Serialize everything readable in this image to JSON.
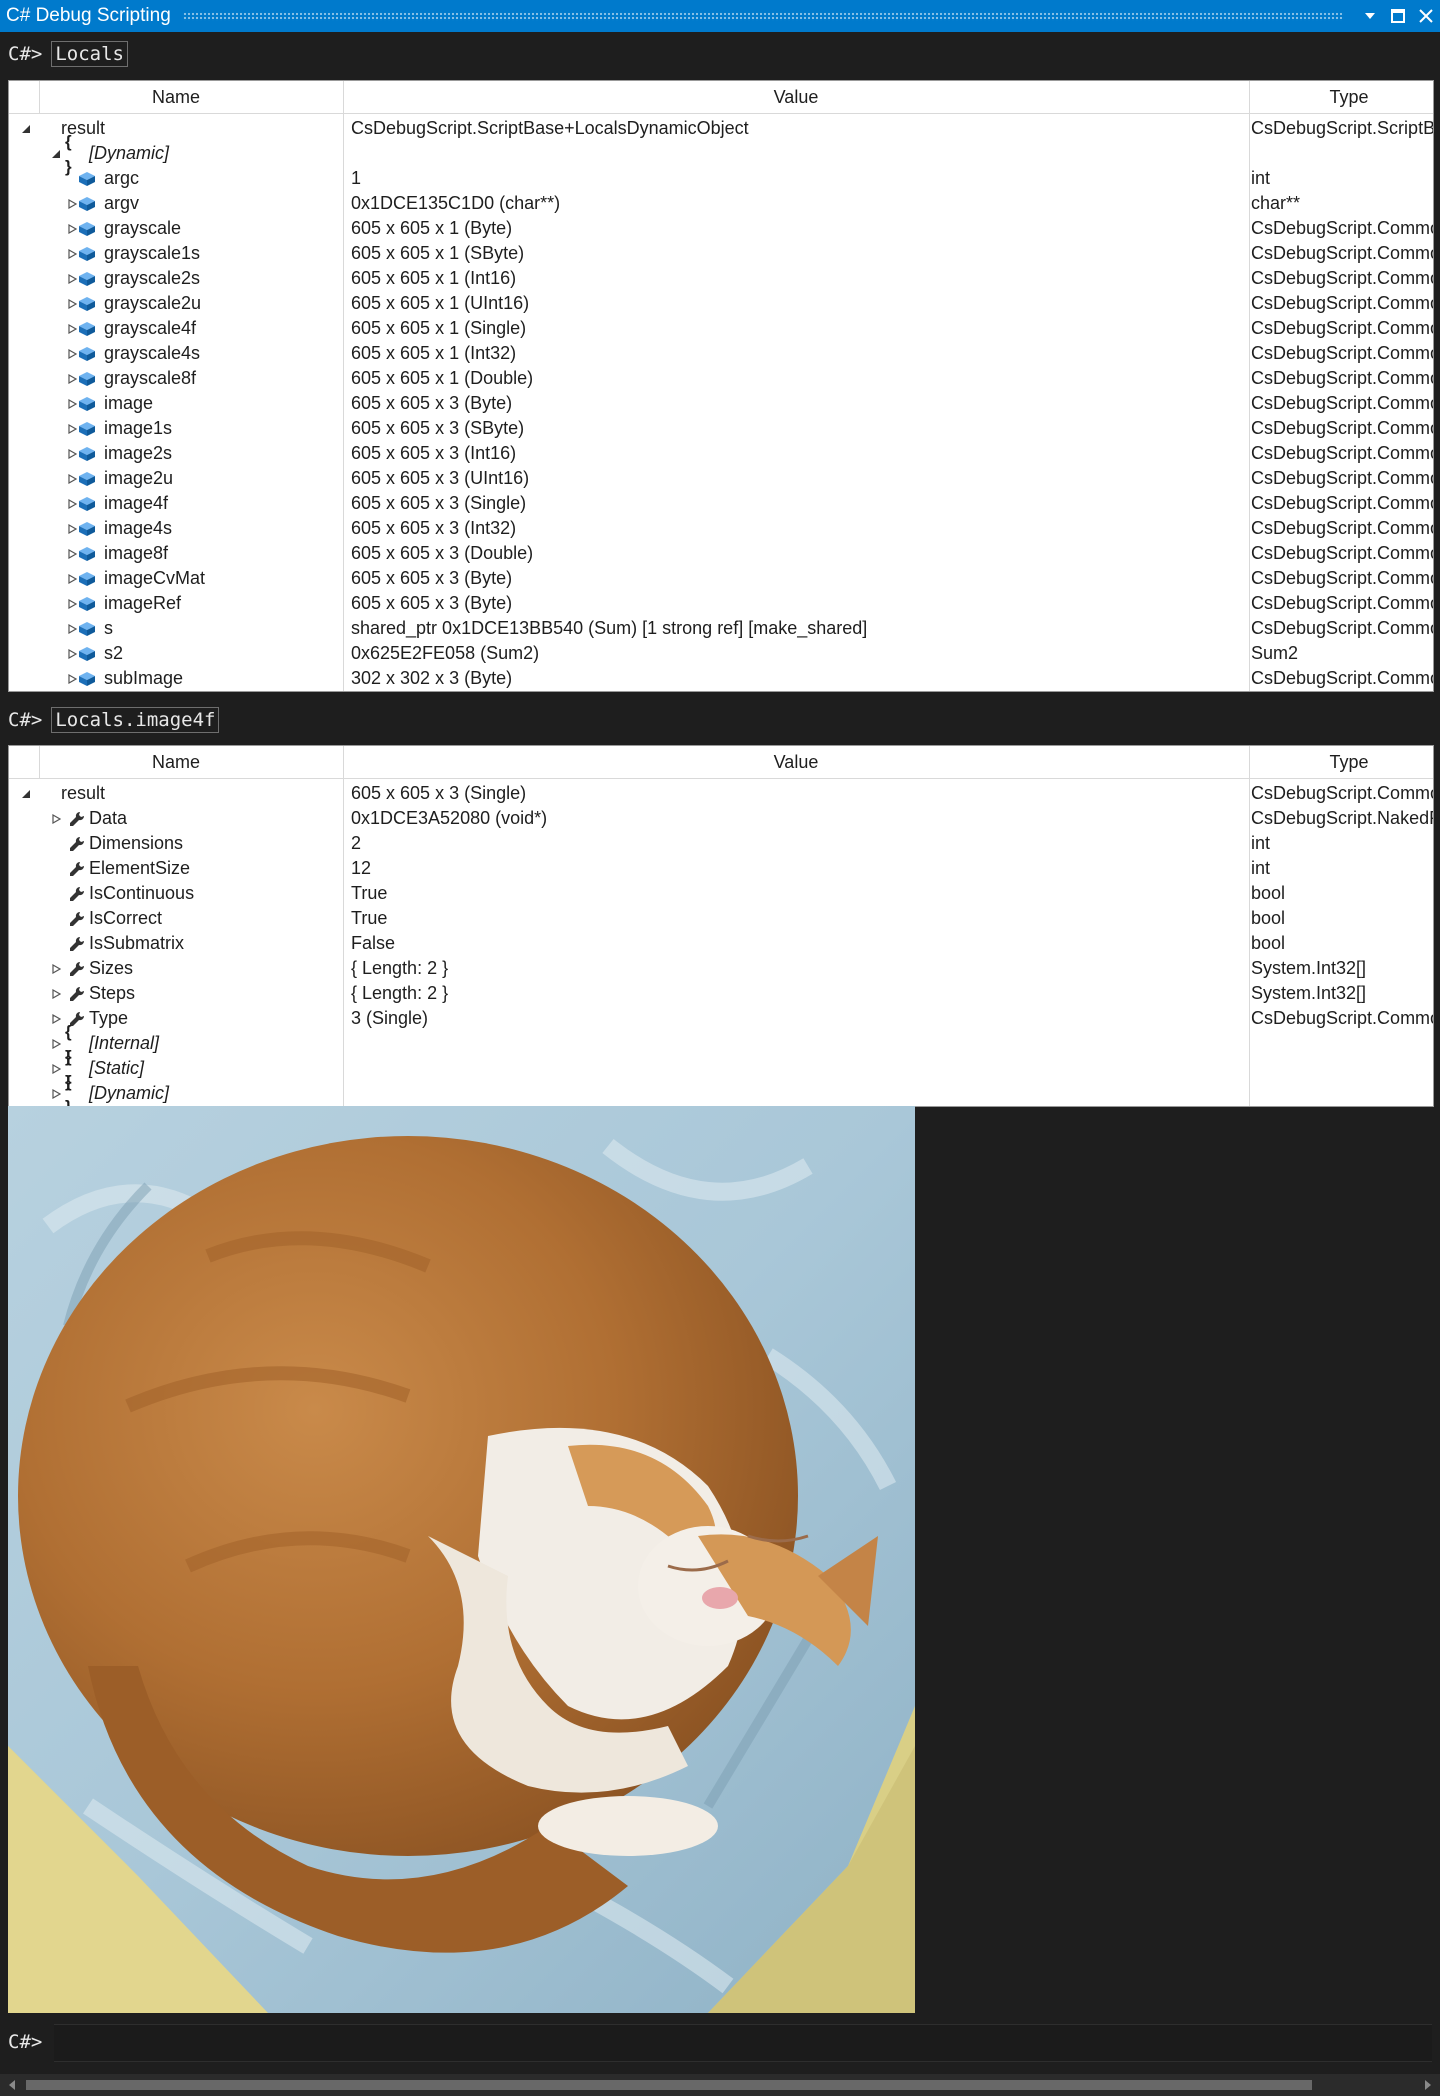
{
  "window": {
    "title": "C# Debug Scripting",
    "accent": "#007acc",
    "background": "#1e1e1e"
  },
  "console": {
    "prompt": "C#>",
    "command1": "Locals",
    "command2": "Locals.image4f"
  },
  "columns": {
    "name": "Name",
    "value": "Value",
    "type": "Type"
  },
  "locals_rows": [
    {
      "name": "result",
      "value": "CsDebugScript.ScriptBase+LocalsDynamicObject",
      "type": "CsDebugScript.ScriptBa"
    },
    {
      "name": "[Dynamic]",
      "value": "",
      "type": ""
    },
    {
      "name": "argc",
      "value": "1",
      "type": "int"
    },
    {
      "name": "argv",
      "value": "0x1DCE135C1D0 (char**)",
      "type": "char**"
    },
    {
      "name": "grayscale",
      "value": "605 x 605 x 1 (Byte)",
      "type": "CsDebugScript.Commo"
    },
    {
      "name": "grayscale1s",
      "value": "605 x 605 x 1 (SByte)",
      "type": "CsDebugScript.Commo"
    },
    {
      "name": "grayscale2s",
      "value": "605 x 605 x 1 (Int16)",
      "type": "CsDebugScript.Commo"
    },
    {
      "name": "grayscale2u",
      "value": "605 x 605 x 1 (UInt16)",
      "type": "CsDebugScript.Commo"
    },
    {
      "name": "grayscale4f",
      "value": "605 x 605 x 1 (Single)",
      "type": "CsDebugScript.Commo"
    },
    {
      "name": "grayscale4s",
      "value": "605 x 605 x 1 (Int32)",
      "type": "CsDebugScript.Commo"
    },
    {
      "name": "grayscale8f",
      "value": "605 x 605 x 1 (Double)",
      "type": "CsDebugScript.Commo"
    },
    {
      "name": "image",
      "value": "605 x 605 x 3 (Byte)",
      "type": "CsDebugScript.Commo"
    },
    {
      "name": "image1s",
      "value": "605 x 605 x 3 (SByte)",
      "type": "CsDebugScript.Commo"
    },
    {
      "name": "image2s",
      "value": "605 x 605 x 3 (Int16)",
      "type": "CsDebugScript.Commo"
    },
    {
      "name": "image2u",
      "value": "605 x 605 x 3 (UInt16)",
      "type": "CsDebugScript.Commo"
    },
    {
      "name": "image4f",
      "value": "605 x 605 x 3 (Single)",
      "type": "CsDebugScript.Commo"
    },
    {
      "name": "image4s",
      "value": "605 x 605 x 3 (Int32)",
      "type": "CsDebugScript.Commo"
    },
    {
      "name": "image8f",
      "value": "605 x 605 x 3 (Double)",
      "type": "CsDebugScript.Commo"
    },
    {
      "name": "imageCvMat",
      "value": "605 x 605 x 3 (Byte)",
      "type": "CsDebugScript.Commo"
    },
    {
      "name": "imageRef",
      "value": "605 x 605 x 3 (Byte)",
      "type": "CsDebugScript.Commo"
    },
    {
      "name": "s",
      "value": "shared_ptr 0x1DCE13BB540 (Sum) [1 strong ref] [make_shared]",
      "type": "CsDebugScript.Commo"
    },
    {
      "name": "s2",
      "value": "0x625E2FE058 (Sum2)",
      "type": "Sum2"
    },
    {
      "name": "subImage",
      "value": "302 x 302 x 3 (Byte)",
      "type": "CsDebugScript.Commo"
    }
  ],
  "image4f_rows": [
    {
      "name": "result",
      "value": "605 x 605 x 3 (Single)",
      "type": "CsDebugScript.Commo"
    },
    {
      "name": "Data",
      "value": "0x1DCE3A52080 (void*)",
      "type": "CsDebugScript.NakedP"
    },
    {
      "name": "Dimensions",
      "value": "2",
      "type": "int"
    },
    {
      "name": "ElementSize",
      "value": "12",
      "type": "int"
    },
    {
      "name": "IsContinuous",
      "value": "True",
      "type": "bool"
    },
    {
      "name": "IsCorrect",
      "value": "True",
      "type": "bool"
    },
    {
      "name": "IsSubmatrix",
      "value": "False",
      "type": "bool"
    },
    {
      "name": "Sizes",
      "value": "{ Length: 2 }",
      "type": "System.Int32[]"
    },
    {
      "name": "Steps",
      "value": "{ Length: 2 }",
      "type": "System.Int32[]"
    },
    {
      "name": "Type",
      "value": "3 (Single)",
      "type": "CsDebugScript.Commo"
    },
    {
      "name": "[Internal]",
      "value": "",
      "type": ""
    },
    {
      "name": "[Static]",
      "value": "",
      "type": ""
    },
    {
      "name": "[Dynamic]",
      "value": "",
      "type": ""
    }
  ]
}
